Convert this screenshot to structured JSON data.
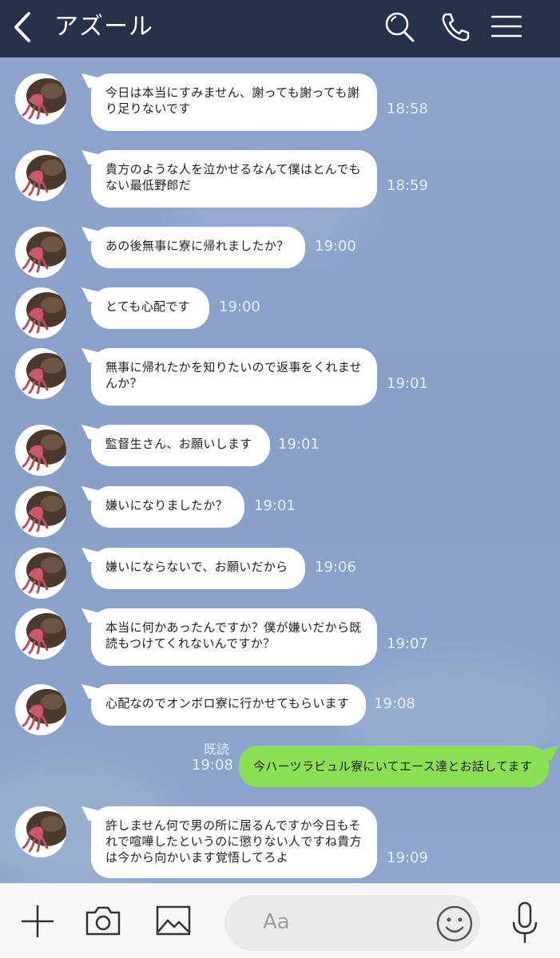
{
  "header": {
    "title": "アズール",
    "bg": "#273149"
  },
  "messages": [
    {
      "text": "今日は本当にすみません、謝っても謝っても謝\n り足りないです",
      "time": "18:58"
    },
    {
      "text": "貴方のような人を泣かせるなんて僕はとんでも\n ない最低野郎だ",
      "time": "18:59"
    },
    {
      "text": "あの後無事に寮に帰れましたか？",
      "time": "19:00"
    },
    {
      "text": "とても心配です",
      "time": "19:00"
    },
    {
      "text": "無事に帰れたかを知りたいので返事をくれませ\n んか？",
      "time": "19:01"
    },
    {
      "text": "監督生さん、お願いします",
      "time": "19:01"
    },
    {
      "text": "嫌いになりましたか？",
      "time": "19:01"
    },
    {
      "text": "嫌いにならないで、お願いだから",
      "time": "19:06"
    },
    {
      "text": "本当に何かあったんですか？僕が嫌いだから既\n 読もつけてくれないんですか？",
      "time": "19:07"
    },
    {
      "text": "心配なのでオンボロ寮に行かせてもらいます",
      "time": "19:08"
    },
    {
      "text": "許しません何で男の所に居るんですか今日もそ\n れで喧嘩したというのに懲りない人ですね貴方\n は今から向かいます覚悟してろよ",
      "time": "19:09"
    }
  ],
  "sent": {
    "text": "今ハーツラビュル寮にいてエース達とお話してます",
    "read_label": "既読",
    "time": "19:08",
    "bubble_color": "#8de055"
  },
  "input": {
    "placeholder": "Aa"
  },
  "icons": [
    "back-chevron-icon",
    "search-icon",
    "phone-icon",
    "menu-icon",
    "plus-icon",
    "camera-icon",
    "image-icon",
    "smiley-icon",
    "microphone-icon"
  ]
}
